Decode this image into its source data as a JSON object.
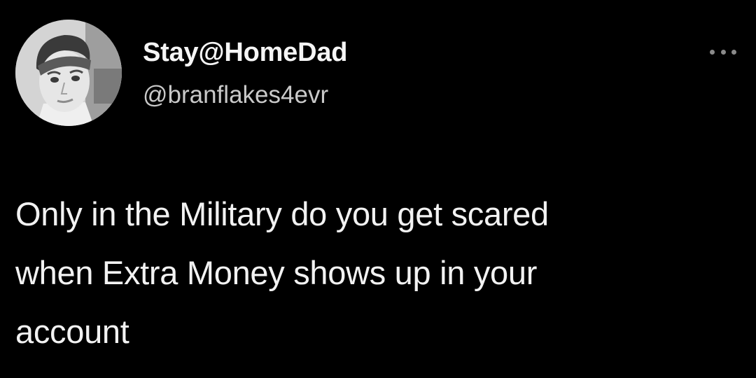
{
  "tweet": {
    "author": {
      "display_name": "Stay@HomeDad",
      "handle": "@branflakes4evr",
      "avatar_icon": "profile-photo"
    },
    "more_icon": "ellipsis-icon",
    "text_lines": [
      "Only in the Military do you get scared",
      "when Extra Money shows up in your",
      "account"
    ]
  },
  "colors": {
    "background": "#000000",
    "text_primary": "#f2f2f2",
    "text_secondary": "#c9c9c9",
    "icon_muted": "#8a8a8a"
  }
}
